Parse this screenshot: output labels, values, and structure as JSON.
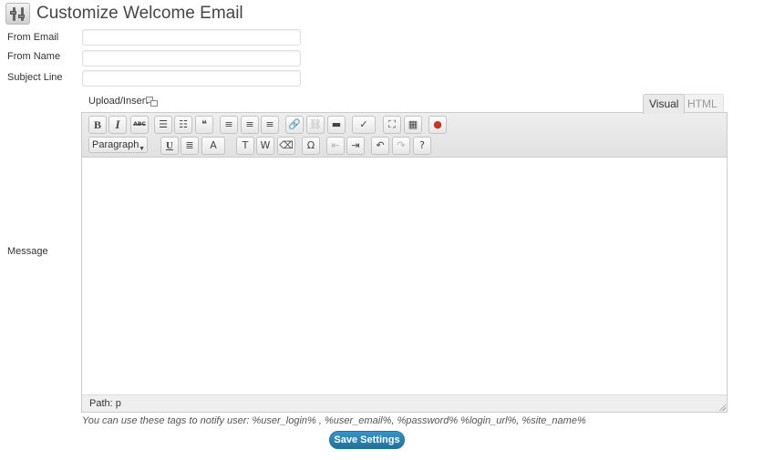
{
  "page": {
    "title": "Customize Welcome Email",
    "icon": "tools-settings-icon"
  },
  "form": {
    "from_email": {
      "label": "From Email",
      "value": ""
    },
    "from_name": {
      "label": "From Name",
      "value": ""
    },
    "subject_line": {
      "label": "Subject Line",
      "value": ""
    },
    "message": {
      "label": "Message"
    }
  },
  "editor": {
    "upload_insert_label": "Upload/Insert",
    "tabs": [
      {
        "label": "Visual",
        "active": true
      },
      {
        "label": "HTML",
        "active": false
      }
    ],
    "toolbar_row1": [
      {
        "icon": "bold-icon",
        "glyph": "B"
      },
      {
        "icon": "italic-icon",
        "glyph": "I"
      },
      {
        "icon": "strikethrough-icon",
        "glyph": "ABC"
      },
      {
        "icon": "bullet-list-icon",
        "glyph": "☰"
      },
      {
        "icon": "numbered-list-icon",
        "glyph": "☷"
      },
      {
        "icon": "blockquote-icon",
        "glyph": "❝"
      },
      {
        "icon": "align-left-icon",
        "glyph": "≡"
      },
      {
        "icon": "align-center-icon",
        "glyph": "≡"
      },
      {
        "icon": "align-right-icon",
        "glyph": "≡"
      },
      {
        "icon": "insert-link-icon",
        "glyph": "🔗"
      },
      {
        "icon": "unlink-icon",
        "glyph": "⛓"
      },
      {
        "icon": "insert-more-icon",
        "glyph": "▬"
      },
      {
        "icon": "spellcheck-icon",
        "glyph": "✓"
      },
      {
        "icon": "fullscreen-icon",
        "glyph": "⛶"
      },
      {
        "icon": "kitchen-sink-icon",
        "glyph": "▦"
      },
      {
        "icon": "insert-media-icon",
        "glyph": "●"
      }
    ],
    "toolbar_row2": [
      {
        "icon": "underline-icon",
        "glyph": "U"
      },
      {
        "icon": "justify-icon",
        "glyph": "≣"
      },
      {
        "icon": "text-color-icon",
        "glyph": "A"
      },
      {
        "icon": "paste-text-icon",
        "glyph": "T"
      },
      {
        "icon": "paste-word-icon",
        "glyph": "W"
      },
      {
        "icon": "remove-format-icon",
        "glyph": "⌫"
      },
      {
        "icon": "special-character-icon",
        "glyph": "Ω"
      },
      {
        "icon": "outdent-icon",
        "glyph": "⇤"
      },
      {
        "icon": "indent-icon",
        "glyph": "⇥"
      },
      {
        "icon": "undo-icon",
        "glyph": "↶"
      },
      {
        "icon": "redo-icon",
        "glyph": "↷"
      },
      {
        "icon": "help-icon",
        "glyph": "?"
      }
    ],
    "format_select": "Paragraph",
    "path": "Path: p"
  },
  "hint": "You can use these tags to notify user: %user_login% , %user_email%, %password% %login_url%, %site_name%",
  "actions": {
    "save_label": "Save Settings"
  },
  "colors": {
    "primary_button": "#2a83b5",
    "title": "#464646"
  }
}
